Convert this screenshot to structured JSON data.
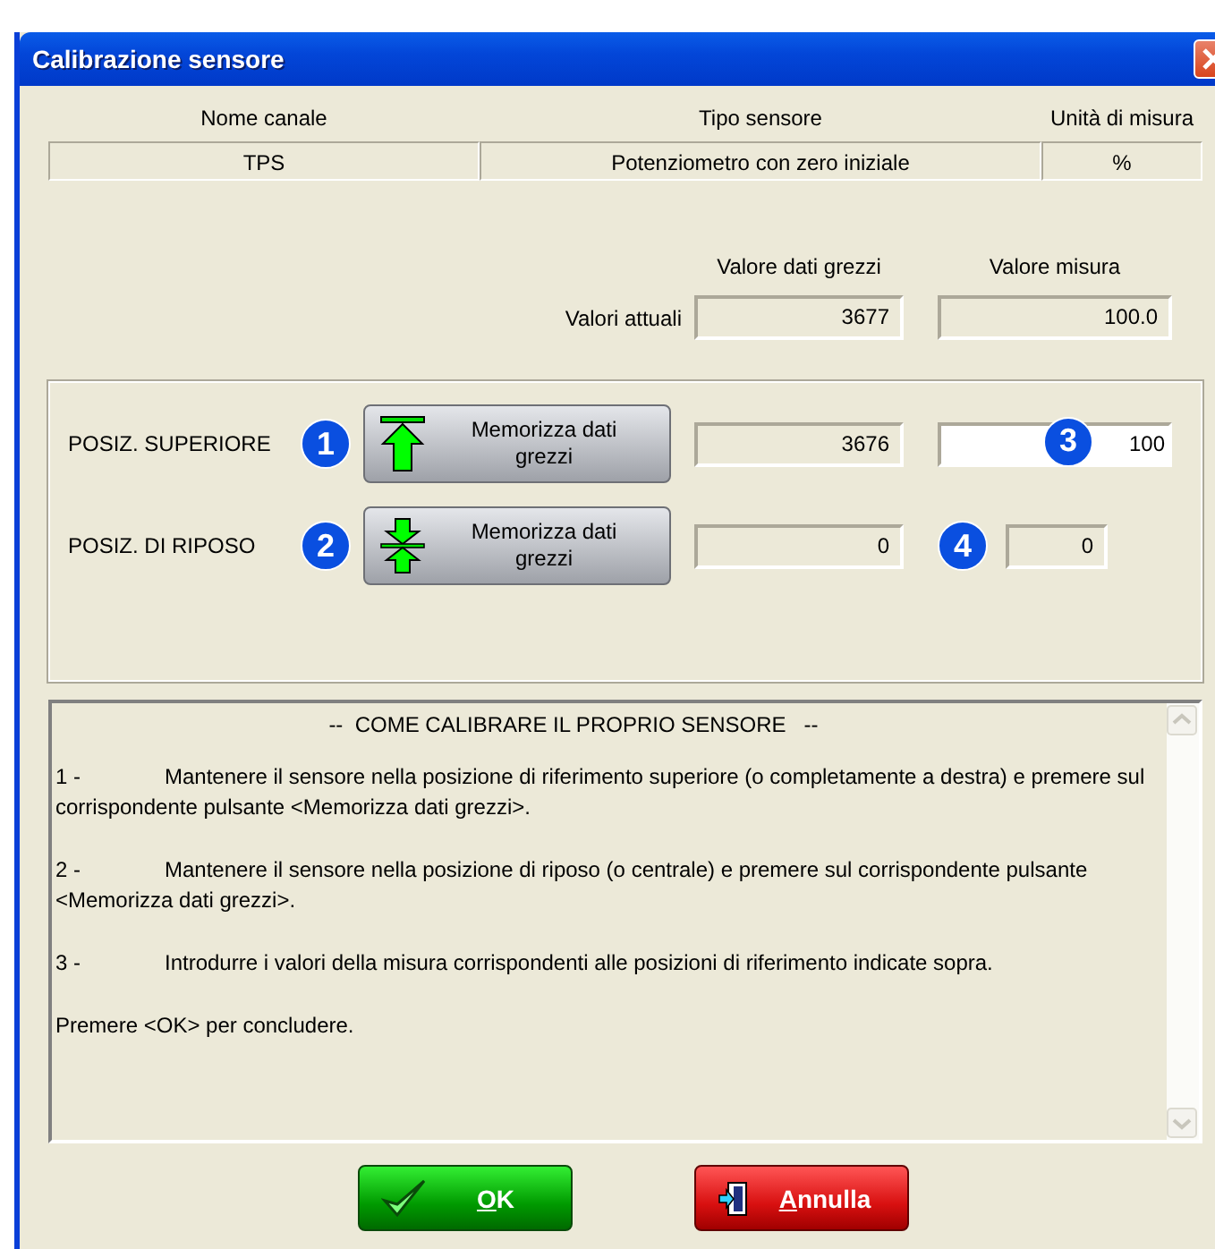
{
  "window": {
    "title": "Calibrazione sensore"
  },
  "channel_table": {
    "columns": [
      "Nome canale",
      "Tipo sensore",
      "Unità di misura"
    ],
    "values": [
      "TPS",
      "Potenziometro con zero iniziale",
      "%"
    ]
  },
  "current_values": {
    "columns": [
      "Valore dati grezzi",
      "Valore misura"
    ],
    "label": "Valori attuali",
    "values": [
      "3677",
      "100.0"
    ]
  },
  "positions": [
    {
      "label": "POSIZ. SUPERIORE",
      "badge": "1",
      "kind": "up",
      "button": "Memorizza dati grezzi",
      "raw_value": "3676",
      "measure_badge": "3",
      "measure_value": "100",
      "editable": true
    },
    {
      "label": "POSIZ. DI RIPOSO",
      "badge": "2",
      "kind": "center",
      "button": "Memorizza dati grezzi",
      "raw_value": "0",
      "measure_badge": "4",
      "measure_value": "0",
      "editable": false
    }
  ],
  "instructions": {
    "heading": "--  COME CALIBRARE IL PROPRIO SENSORE   --",
    "steps": [
      {
        "number": "1 -",
        "text": "Mantenere il sensore nella posizione di riferimento superiore (o completamente a destra) e premere sul corrispondente pulsante <Memorizza dati grezzi>."
      },
      {
        "number": "2 -",
        "text": "Mantenere il sensore nella posizione di riposo (o centrale) e premere sul corrispondente pulsante <Memorizza dati grezzi>."
      },
      {
        "number": "3 -",
        "text": "Introdurre i valori della misura corrispondenti alle posizioni di riferimento indicate sopra."
      }
    ],
    "closing": "Premere <OK> per concludere."
  },
  "buttons": [
    {
      "label": "OK",
      "kind": "ok"
    },
    {
      "label": "Annulla",
      "kind": "cancel"
    }
  ]
}
